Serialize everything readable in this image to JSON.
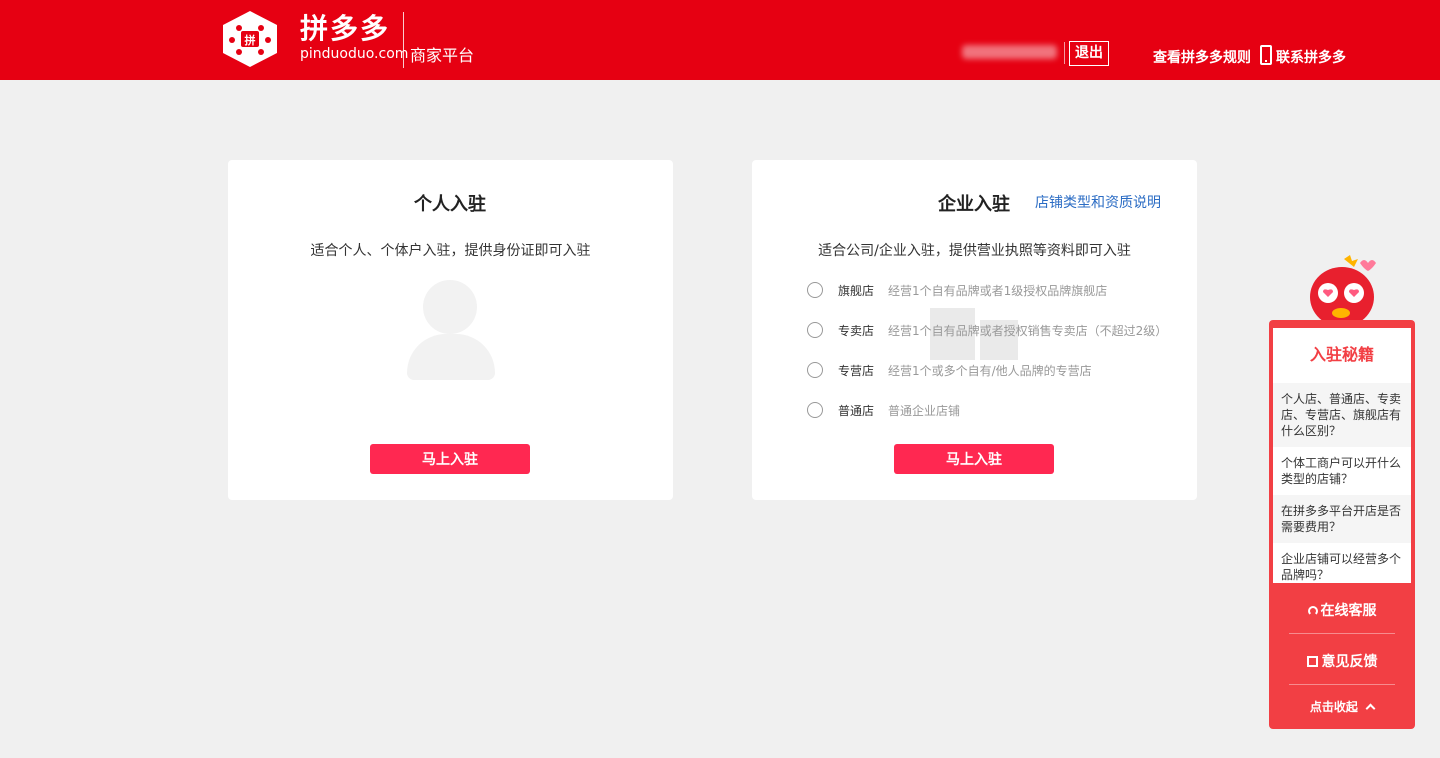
{
  "header": {
    "brand_name": "拼多多",
    "brand_domain": "pinduoduo.com",
    "platform": "商家平台",
    "logout_label": "退出",
    "rules_label": "查看拼多多规则",
    "contact_label": "联系拼多多",
    "brand_color": "#e60012"
  },
  "personal": {
    "title": "个人入驻",
    "desc": "适合个人、个体户入驻，提供身份证即可入驻",
    "button": "马上入驻"
  },
  "enterprise": {
    "title": "企业入驻",
    "help_link": "店铺类型和资质说明",
    "desc": "适合公司/企业入驻，提供营业执照等资料即可入驻",
    "button": "马上入驻",
    "shop_types": [
      {
        "name": "旗舰店",
        "desc": "经营1个自有品牌或者1级授权品牌旗舰店"
      },
      {
        "name": "专卖店",
        "desc": "经营1个自有品牌或者授权销售专卖店（不超过2级）"
      },
      {
        "name": "专营店",
        "desc": "经营1个或多个自有/他人品牌的专营店"
      },
      {
        "name": "普通店",
        "desc": "普通企业店铺"
      }
    ]
  },
  "side": {
    "title": "入驻秘籍",
    "tips": [
      "个人店、普通店、专卖店、专营店、旗舰店有什么区别？",
      "个体工商户可以开什么类型的店铺？",
      "在拼多多平台开店是否需要费用？",
      "企业店铺可以经营多个品牌吗？"
    ],
    "online_service": "在线客服",
    "feedback": "意见反馈",
    "collapse": "点击收起",
    "accent_color": "#f23f44"
  },
  "button_color": "#ff2851"
}
